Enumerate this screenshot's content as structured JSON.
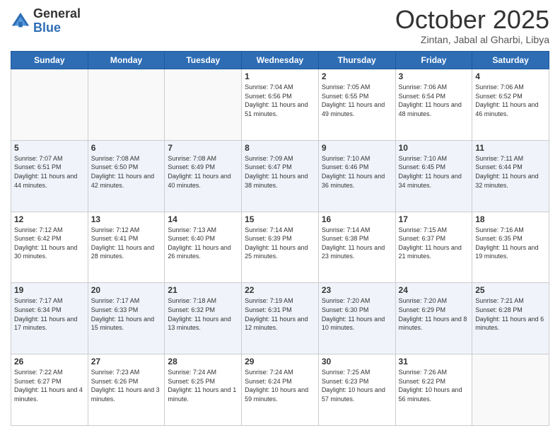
{
  "logo": {
    "general": "General",
    "blue": "Blue"
  },
  "title": "October 2025",
  "location": "Zintan, Jabal al Gharbi, Libya",
  "days_of_week": [
    "Sunday",
    "Monday",
    "Tuesday",
    "Wednesday",
    "Thursday",
    "Friday",
    "Saturday"
  ],
  "weeks": [
    [
      {
        "day": "",
        "sunrise": "",
        "sunset": "",
        "daylight": ""
      },
      {
        "day": "",
        "sunrise": "",
        "sunset": "",
        "daylight": ""
      },
      {
        "day": "",
        "sunrise": "",
        "sunset": "",
        "daylight": ""
      },
      {
        "day": "1",
        "sunrise": "Sunrise: 7:04 AM",
        "sunset": "Sunset: 6:56 PM",
        "daylight": "Daylight: 11 hours and 51 minutes."
      },
      {
        "day": "2",
        "sunrise": "Sunrise: 7:05 AM",
        "sunset": "Sunset: 6:55 PM",
        "daylight": "Daylight: 11 hours and 49 minutes."
      },
      {
        "day": "3",
        "sunrise": "Sunrise: 7:06 AM",
        "sunset": "Sunset: 6:54 PM",
        "daylight": "Daylight: 11 hours and 48 minutes."
      },
      {
        "day": "4",
        "sunrise": "Sunrise: 7:06 AM",
        "sunset": "Sunset: 6:52 PM",
        "daylight": "Daylight: 11 hours and 46 minutes."
      }
    ],
    [
      {
        "day": "5",
        "sunrise": "Sunrise: 7:07 AM",
        "sunset": "Sunset: 6:51 PM",
        "daylight": "Daylight: 11 hours and 44 minutes."
      },
      {
        "day": "6",
        "sunrise": "Sunrise: 7:08 AM",
        "sunset": "Sunset: 6:50 PM",
        "daylight": "Daylight: 11 hours and 42 minutes."
      },
      {
        "day": "7",
        "sunrise": "Sunrise: 7:08 AM",
        "sunset": "Sunset: 6:49 PM",
        "daylight": "Daylight: 11 hours and 40 minutes."
      },
      {
        "day": "8",
        "sunrise": "Sunrise: 7:09 AM",
        "sunset": "Sunset: 6:47 PM",
        "daylight": "Daylight: 11 hours and 38 minutes."
      },
      {
        "day": "9",
        "sunrise": "Sunrise: 7:10 AM",
        "sunset": "Sunset: 6:46 PM",
        "daylight": "Daylight: 11 hours and 36 minutes."
      },
      {
        "day": "10",
        "sunrise": "Sunrise: 7:10 AM",
        "sunset": "Sunset: 6:45 PM",
        "daylight": "Daylight: 11 hours and 34 minutes."
      },
      {
        "day": "11",
        "sunrise": "Sunrise: 7:11 AM",
        "sunset": "Sunset: 6:44 PM",
        "daylight": "Daylight: 11 hours and 32 minutes."
      }
    ],
    [
      {
        "day": "12",
        "sunrise": "Sunrise: 7:12 AM",
        "sunset": "Sunset: 6:42 PM",
        "daylight": "Daylight: 11 hours and 30 minutes."
      },
      {
        "day": "13",
        "sunrise": "Sunrise: 7:12 AM",
        "sunset": "Sunset: 6:41 PM",
        "daylight": "Daylight: 11 hours and 28 minutes."
      },
      {
        "day": "14",
        "sunrise": "Sunrise: 7:13 AM",
        "sunset": "Sunset: 6:40 PM",
        "daylight": "Daylight: 11 hours and 26 minutes."
      },
      {
        "day": "15",
        "sunrise": "Sunrise: 7:14 AM",
        "sunset": "Sunset: 6:39 PM",
        "daylight": "Daylight: 11 hours and 25 minutes."
      },
      {
        "day": "16",
        "sunrise": "Sunrise: 7:14 AM",
        "sunset": "Sunset: 6:38 PM",
        "daylight": "Daylight: 11 hours and 23 minutes."
      },
      {
        "day": "17",
        "sunrise": "Sunrise: 7:15 AM",
        "sunset": "Sunset: 6:37 PM",
        "daylight": "Daylight: 11 hours and 21 minutes."
      },
      {
        "day": "18",
        "sunrise": "Sunrise: 7:16 AM",
        "sunset": "Sunset: 6:35 PM",
        "daylight": "Daylight: 11 hours and 19 minutes."
      }
    ],
    [
      {
        "day": "19",
        "sunrise": "Sunrise: 7:17 AM",
        "sunset": "Sunset: 6:34 PM",
        "daylight": "Daylight: 11 hours and 17 minutes."
      },
      {
        "day": "20",
        "sunrise": "Sunrise: 7:17 AM",
        "sunset": "Sunset: 6:33 PM",
        "daylight": "Daylight: 11 hours and 15 minutes."
      },
      {
        "day": "21",
        "sunrise": "Sunrise: 7:18 AM",
        "sunset": "Sunset: 6:32 PM",
        "daylight": "Daylight: 11 hours and 13 minutes."
      },
      {
        "day": "22",
        "sunrise": "Sunrise: 7:19 AM",
        "sunset": "Sunset: 6:31 PM",
        "daylight": "Daylight: 11 hours and 12 minutes."
      },
      {
        "day": "23",
        "sunrise": "Sunrise: 7:20 AM",
        "sunset": "Sunset: 6:30 PM",
        "daylight": "Daylight: 11 hours and 10 minutes."
      },
      {
        "day": "24",
        "sunrise": "Sunrise: 7:20 AM",
        "sunset": "Sunset: 6:29 PM",
        "daylight": "Daylight: 11 hours and 8 minutes."
      },
      {
        "day": "25",
        "sunrise": "Sunrise: 7:21 AM",
        "sunset": "Sunset: 6:28 PM",
        "daylight": "Daylight: 11 hours and 6 minutes."
      }
    ],
    [
      {
        "day": "26",
        "sunrise": "Sunrise: 7:22 AM",
        "sunset": "Sunset: 6:27 PM",
        "daylight": "Daylight: 11 hours and 4 minutes."
      },
      {
        "day": "27",
        "sunrise": "Sunrise: 7:23 AM",
        "sunset": "Sunset: 6:26 PM",
        "daylight": "Daylight: 11 hours and 3 minutes."
      },
      {
        "day": "28",
        "sunrise": "Sunrise: 7:24 AM",
        "sunset": "Sunset: 6:25 PM",
        "daylight": "Daylight: 11 hours and 1 minute."
      },
      {
        "day": "29",
        "sunrise": "Sunrise: 7:24 AM",
        "sunset": "Sunset: 6:24 PM",
        "daylight": "Daylight: 10 hours and 59 minutes."
      },
      {
        "day": "30",
        "sunrise": "Sunrise: 7:25 AM",
        "sunset": "Sunset: 6:23 PM",
        "daylight": "Daylight: 10 hours and 57 minutes."
      },
      {
        "day": "31",
        "sunrise": "Sunrise: 7:26 AM",
        "sunset": "Sunset: 6:22 PM",
        "daylight": "Daylight: 10 hours and 56 minutes."
      },
      {
        "day": "",
        "sunrise": "",
        "sunset": "",
        "daylight": ""
      }
    ]
  ]
}
